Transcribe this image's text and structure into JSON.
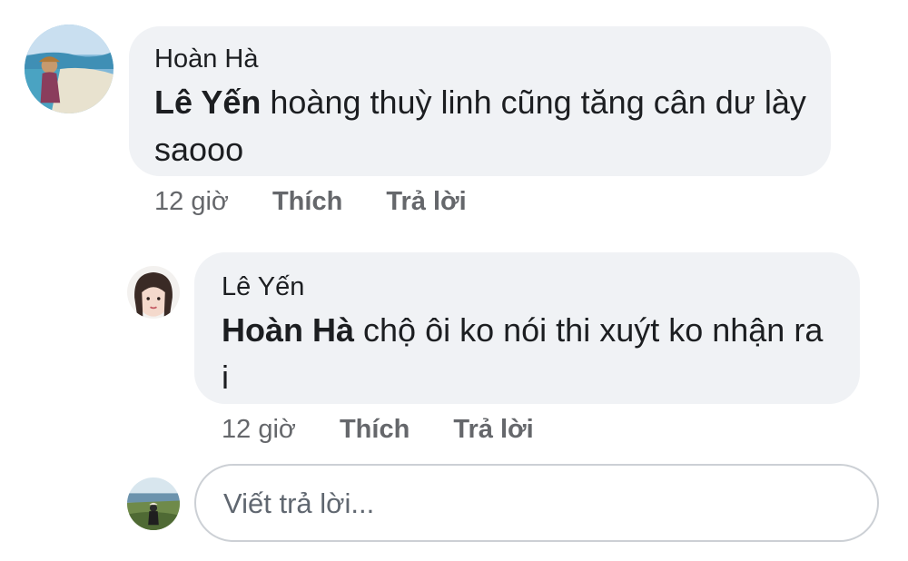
{
  "comments": [
    {
      "author": "Hoàn Hà",
      "mention": "Lê Yến",
      "text": " hoàng thuỳ linh cũng tăng cân dư lày saooo",
      "time": "12 giờ",
      "like_label": "Thích",
      "reply_label": "Trả lời"
    },
    {
      "author": "Lê Yến",
      "mention": "Hoàn Hà",
      "text": " chộ ôi ko nói thi xuýt ko nhận ra i",
      "time": "12 giờ",
      "like_label": "Thích",
      "reply_label": "Trả lời"
    }
  ],
  "reply_input": {
    "placeholder": "Viết trả lời..."
  },
  "colors": {
    "bubble_bg": "#f0f2f5",
    "meta_text": "#65676b",
    "input_border": "#ccd0d5"
  }
}
